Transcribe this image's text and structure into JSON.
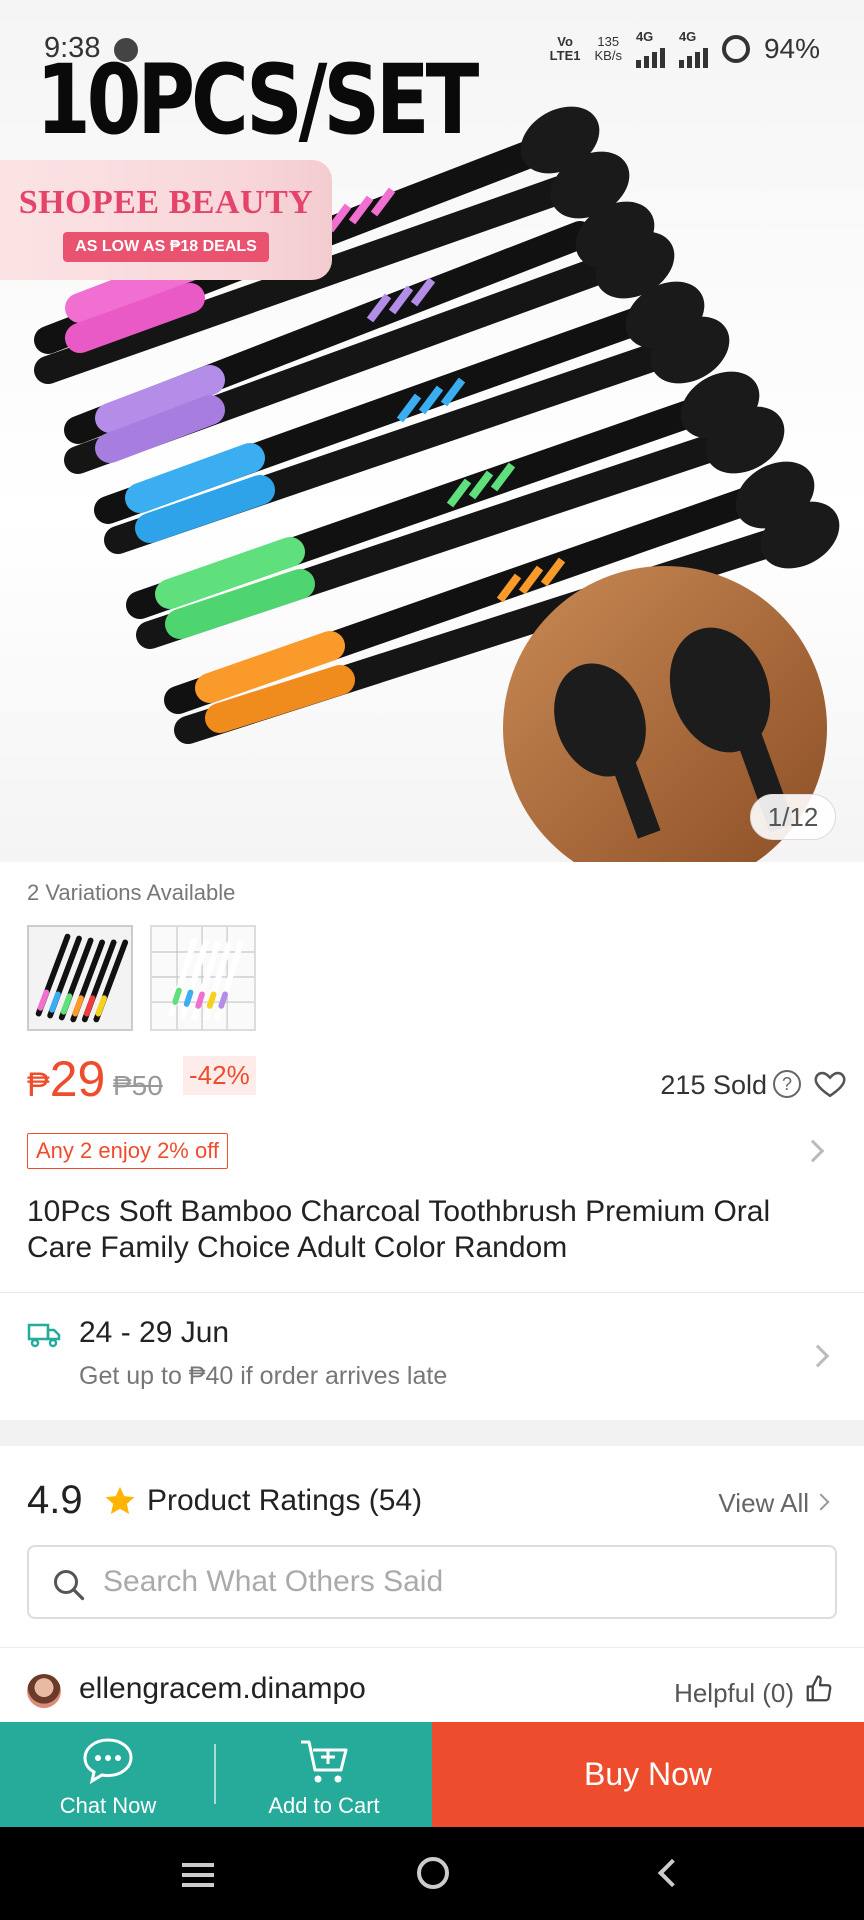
{
  "status_bar": {
    "time": "9:38",
    "net_top": "Vo",
    "net_bottom": "LTE1",
    "speed_value": "135",
    "speed_unit": "KB/s",
    "sig1_label": "4G",
    "sig2_label": "4G",
    "battery": "94%"
  },
  "hero": {
    "headline": "10PCS/SET",
    "banner_title": "SHOPEE BEAUTY",
    "banner_sub": "AS LOW AS ₱18 DEALS",
    "image_counter": "1/12"
  },
  "variations": {
    "label": "2 Variations Available"
  },
  "price": {
    "currency": "₱",
    "current": "29",
    "original": "₱50",
    "discount": "-42%",
    "sold": "215 Sold"
  },
  "promo": {
    "tag": "Any 2 enjoy 2% off"
  },
  "product": {
    "title": "10Pcs Soft Bamboo Charcoal Toothbrush Premium Oral Care Family Choice Adult Color Random"
  },
  "shipping": {
    "dates": "24 - 29 Jun",
    "note": "Get up to ₱40 if order arrives late"
  },
  "ratings": {
    "score": "4.9",
    "title": "Product Ratings (54)",
    "view_all": "View All"
  },
  "search": {
    "placeholder": "Search What Others Said"
  },
  "review": {
    "username": "ellengracem.dinampo",
    "helpful": "Helpful (0)"
  },
  "actions": {
    "chat": "Chat Now",
    "cart": "Add to Cart",
    "buy": "Buy Now"
  },
  "colors": {
    "shopee_orange": "#ee4d2d",
    "teal": "#26aa99"
  }
}
